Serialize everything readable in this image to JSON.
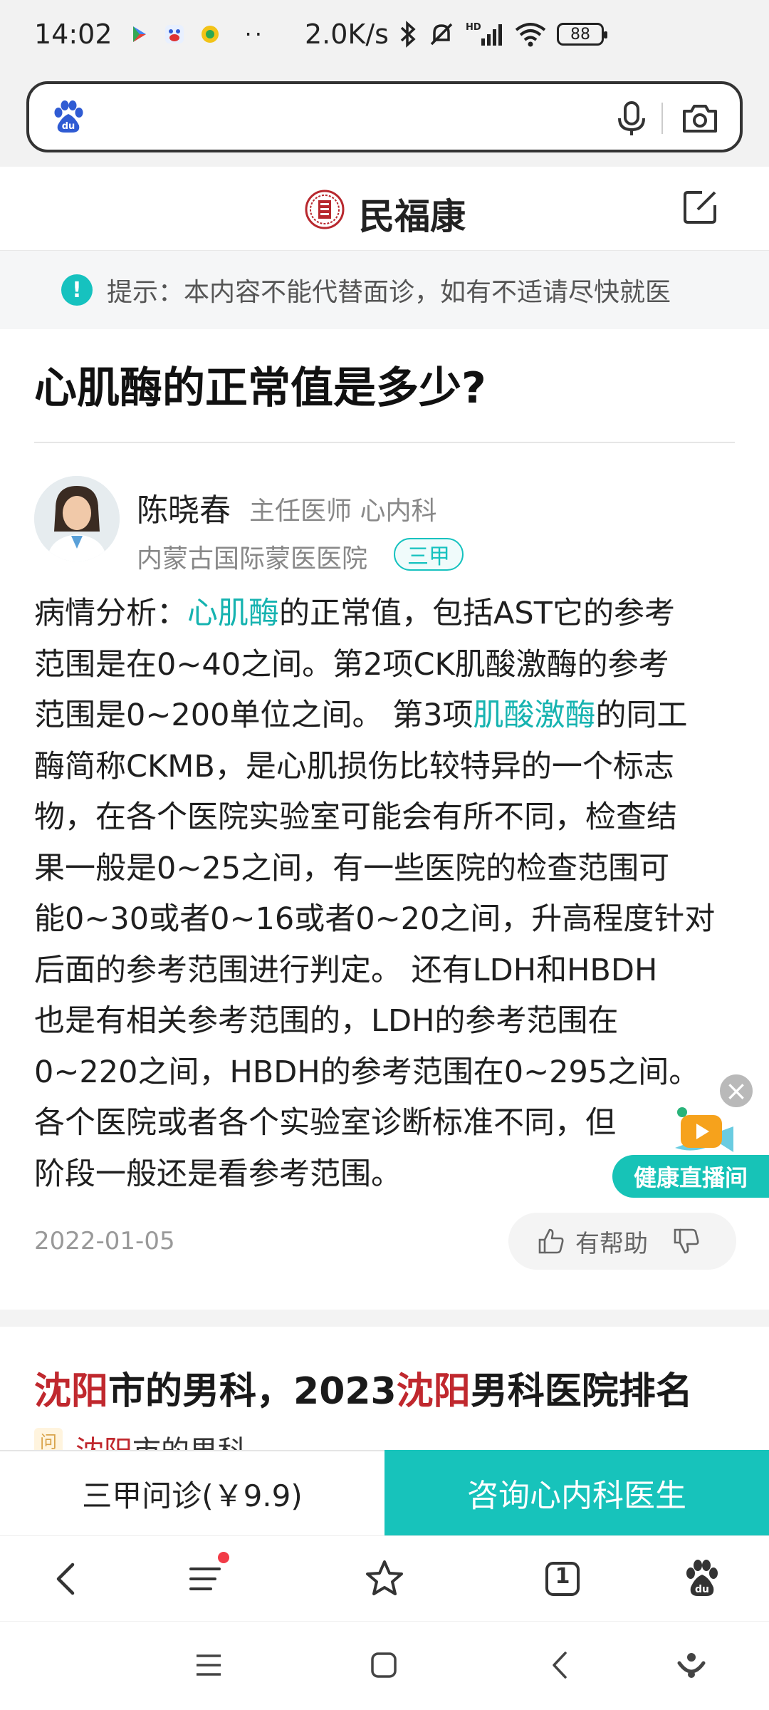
{
  "status_bar": {
    "time": "14:02",
    "dots": "··",
    "net_speed": "2.0K/s",
    "signal": "HD",
    "battery": "88"
  },
  "search": {
    "placeholder": "",
    "icons": [
      "baidu-logo-icon",
      "microphone-icon",
      "camera-icon"
    ]
  },
  "site": {
    "name": "民福康",
    "notice": "提示：本内容不能代替面诊，如有不适请尽快就医"
  },
  "question": {
    "title": "心肌酶的正常值是多少?"
  },
  "doctor": {
    "name": "陈晓春",
    "title": "主任医师  心内科",
    "hospital": "内蒙古国际蒙医医院",
    "grade": "三甲"
  },
  "answer": {
    "lines": [
      [
        "病情分析：",
        "心肌酶",
        "的正常值，包括AST它的参考"
      ],
      [
        "范围是在0~40之间。第2项CK肌酸激酶的参考"
      ],
      [
        "范围是0~200单位之间。 第3项",
        "肌酸激酶",
        "的同工"
      ],
      [
        "酶简称CKMB，是心肌损伤比较特异的一个标志"
      ],
      [
        "物，在各个医院实验室可能会有所不同，检查结"
      ],
      [
        "果一般是0~25之间，有一些医院的检查范围可"
      ],
      [
        "能0~30或者0~16或者0~20之间，升高程度针对"
      ],
      [
        "后面的参考范围进行判定。 还有LDH和HBDH"
      ],
      [
        "也是有相关参考范围的，LDH的参考范围在"
      ],
      [
        "0~220之间，HBDH的参考范围在0~295之间。"
      ],
      [
        "各个医院或者各个实验室诊断标准不同，但"
      ],
      [
        "阶段一般还是看参考范围。"
      ]
    ],
    "date": "2022-01-05",
    "helpful_label": "有帮助"
  },
  "live": {
    "label": "健康直播间",
    "close": "×"
  },
  "related": {
    "title_parts": [
      "沈阳",
      "市的男科，2023",
      "沈阳",
      "男科医院排名"
    ],
    "tag": "问",
    "sub_parts": [
      "沈阳",
      "市的男科"
    ]
  },
  "cta": {
    "left": "三甲问诊(￥9.9)",
    "right": "咨询心内科医生"
  },
  "browser_nav": {
    "tab_count": "1",
    "icons": [
      "back-icon",
      "menu-icon",
      "star-icon",
      "tabs-icon",
      "baidu-paw-icon"
    ]
  },
  "system_nav": {
    "icons": [
      "recent-apps-icon",
      "home-icon",
      "system-back-icon",
      "assistant-icon"
    ]
  },
  "colors": {
    "accent": "#17c3bb",
    "link": "#16b3b0",
    "highlight_red": "#c0282e",
    "notification_dot": "#f23b47"
  }
}
